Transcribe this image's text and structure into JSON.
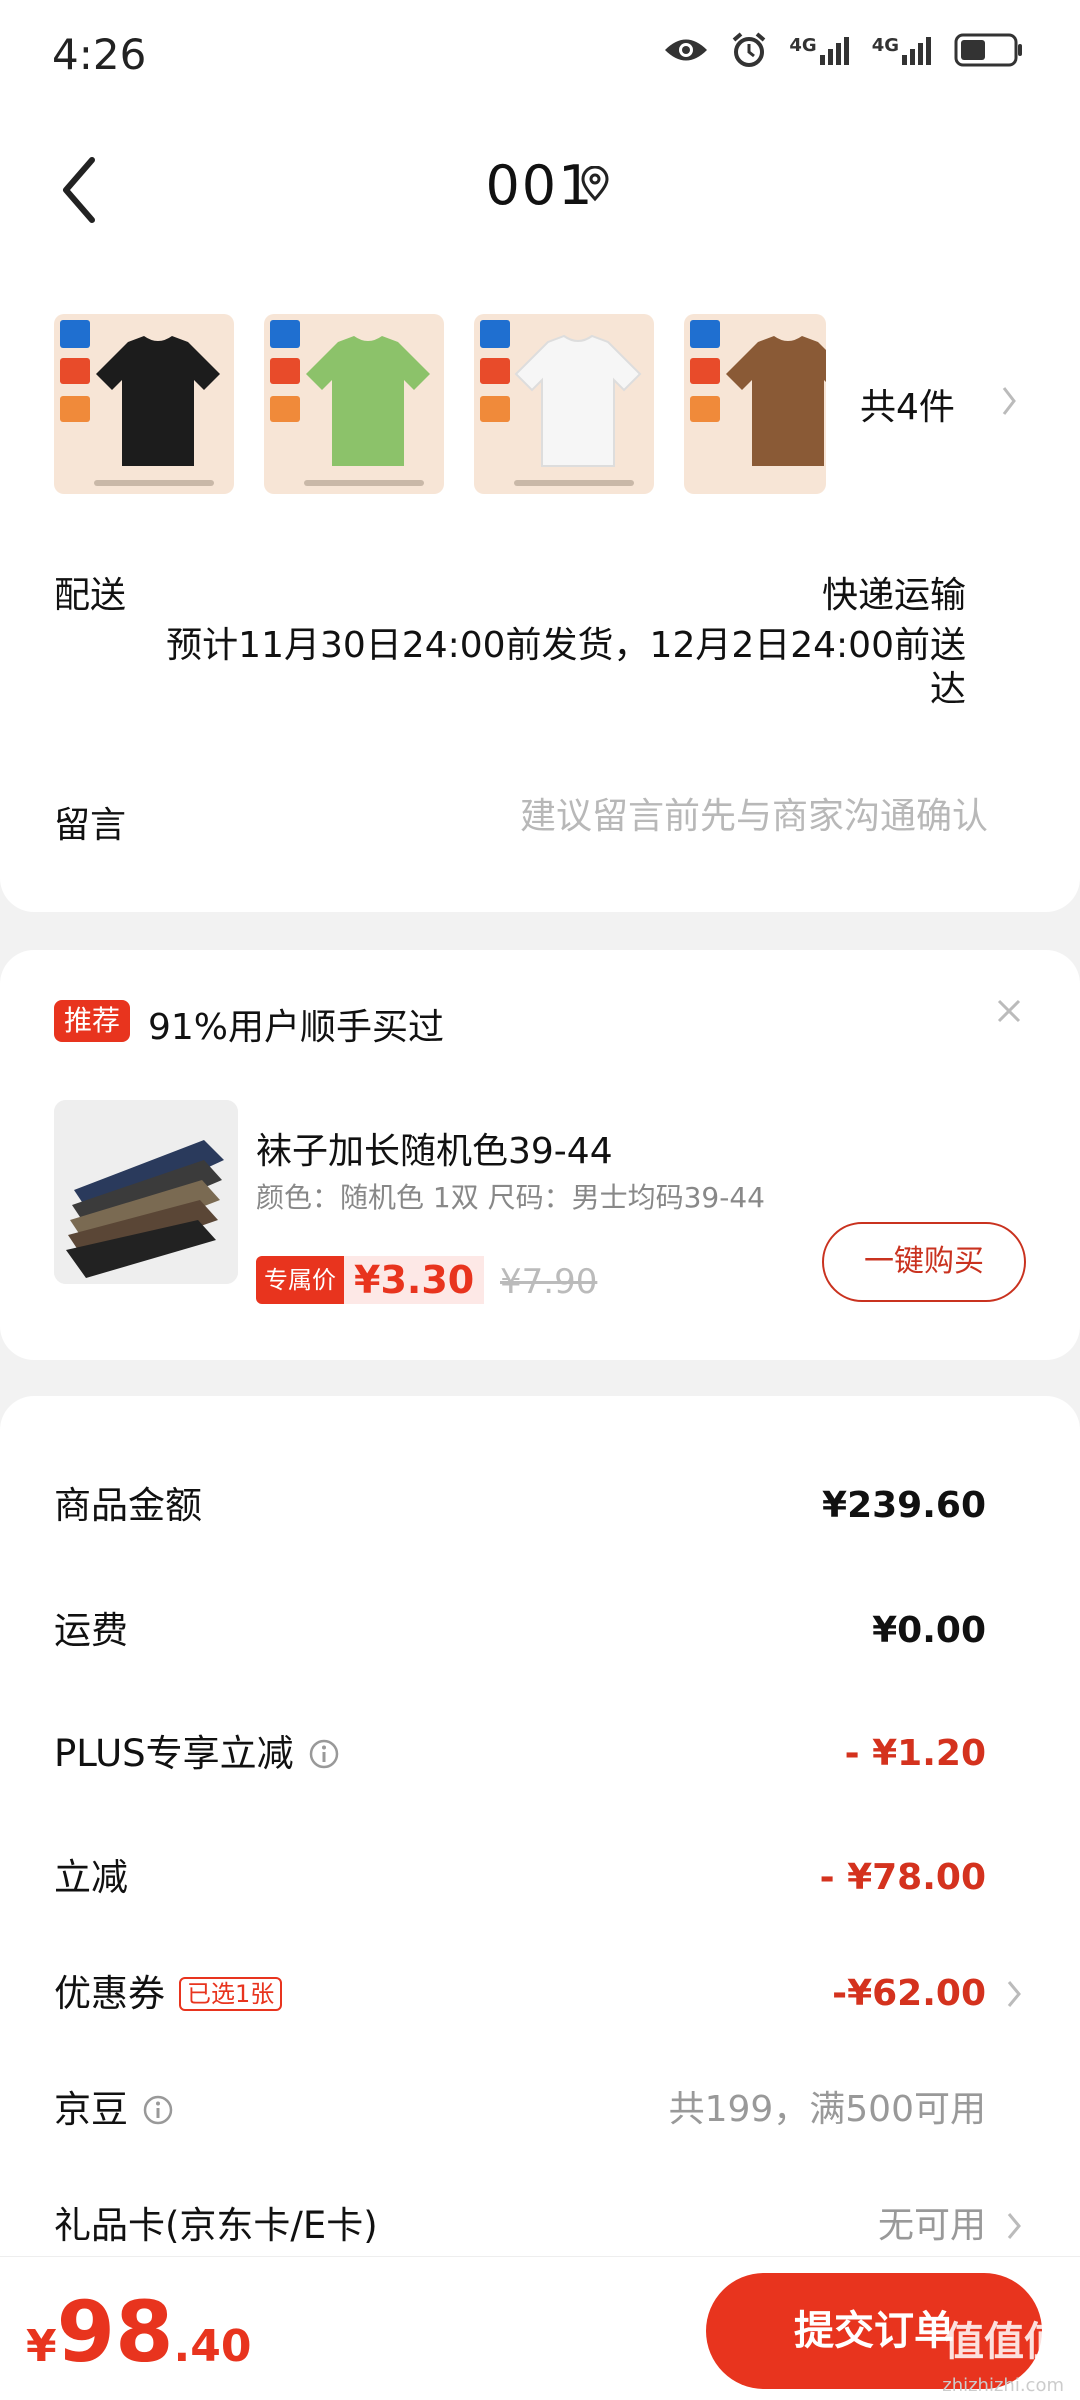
{
  "status": {
    "time": "4:26",
    "net1": "4G",
    "net2": "4G"
  },
  "header": {
    "title": "001"
  },
  "items": {
    "count_label": "共4件"
  },
  "delivery": {
    "label": "配送",
    "method": "快递运输",
    "estimate": "预计11月30日24:00前发货，12月2日24:00前送达"
  },
  "message": {
    "label": "留言",
    "placeholder": "建议留言前先与商家沟通确认"
  },
  "recommend": {
    "badge": "推荐",
    "title": "91%用户顺手买过",
    "product_name": "袜子加长随机色39-44",
    "spec": "颜色：随机色 1双   尺码：男士均码39-44",
    "exclusive_label": "专属价",
    "price": "¥3.30",
    "original_price": "¥7.90",
    "buy_label": "一键购买"
  },
  "summary": {
    "goods_label": "商品金额",
    "goods_value": "¥239.60",
    "freight_label": "运费",
    "freight_value": "¥0.00",
    "plus_label": "PLUS专享立减",
    "plus_value": "- ¥1.20",
    "discount_label": "立减",
    "discount_value": "- ¥78.00",
    "coupon_label": "优惠券",
    "coupon_tag": "已选1张",
    "coupon_value": "-¥62.00",
    "jingdou_label": "京豆",
    "jingdou_value": "共199，满500可用",
    "giftcard_label": "礼品卡(京东卡/E卡)",
    "giftcard_value": "无可用"
  },
  "footer": {
    "currency": "¥",
    "total_int": "98",
    "total_dec": ".40",
    "submit_label": "提交订单",
    "watermark": "值值值",
    "watermark_url": "zhizhizhi.com"
  },
  "colors": {
    "accent": "#e8341e",
    "shirt_colors": [
      "#1c1c1c",
      "#8cc26a",
      "#f3f3f3",
      "#8a5a36"
    ]
  }
}
